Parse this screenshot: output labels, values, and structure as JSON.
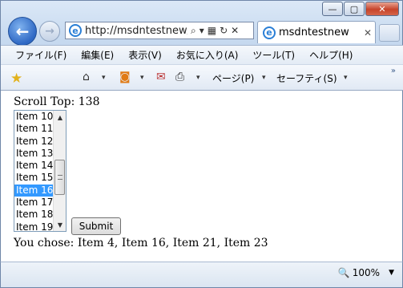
{
  "window": {
    "minimize": "—",
    "maximize": "▢",
    "close": "✕"
  },
  "address_bar": {
    "url": "http://msdntestnew/",
    "search_icon": "search-icon",
    "refresh_icon": "refresh-icon",
    "stop_icon": "stop-icon"
  },
  "tab": {
    "title": "msdntestnew",
    "close": "✕"
  },
  "menu": [
    "ファイル(F)",
    "編集(E)",
    "表示(V)",
    "お気に入り(A)",
    "ツール(T)",
    "ヘルプ(H)"
  ],
  "commandbar": {
    "page_label": "ページ(P)",
    "safety_label": "セーフティ(S)"
  },
  "content": {
    "scroll_top": "Scroll Top: 138",
    "list_items": [
      "Item 10",
      "Item 11",
      "Item 12",
      "Item 13",
      "Item 14",
      "Item 15",
      "Item 16",
      "Item 17",
      "Item 18",
      "Item 19"
    ],
    "selected_index": 6,
    "submit_label": "Submit",
    "result": "You chose: Item 4, Item 16, Item 21, Item 23"
  },
  "status": {
    "zoom": "100%"
  }
}
